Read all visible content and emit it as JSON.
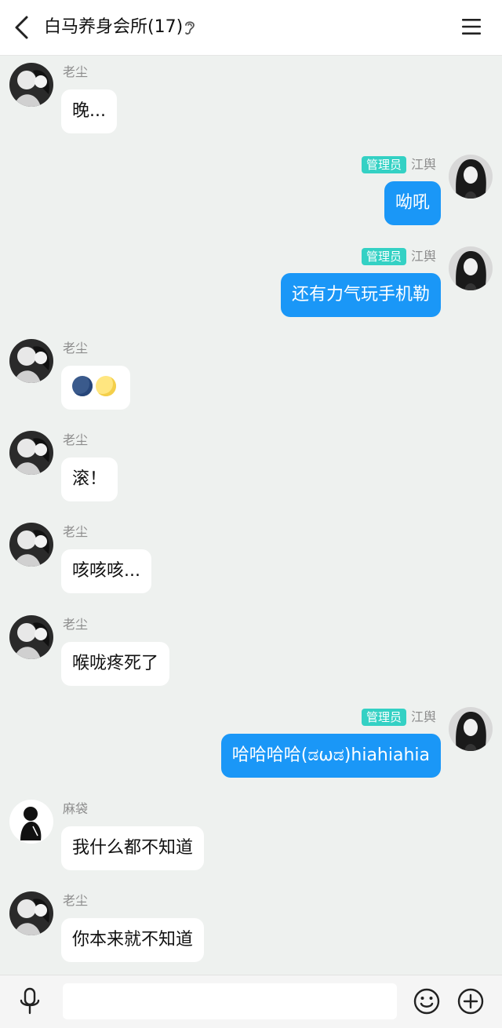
{
  "header": {
    "title": "白马养身会所(17)",
    "back_icon": "chevron-left-icon",
    "ear_icon": "ear-icon",
    "menu_icon": "hamburger-menu-icon"
  },
  "messages": [
    {
      "side": "left",
      "sender": "老尘",
      "text": "晚..."
    },
    {
      "side": "right",
      "sender": "江舆",
      "badge": "管理员",
      "text": "呦吼"
    },
    {
      "side": "right",
      "sender": "江舆",
      "badge": "管理员",
      "text": "还有力气玩手机勒"
    },
    {
      "side": "left",
      "sender": "老尘",
      "text": "",
      "emojis": [
        "new-moon-face",
        "full-moon-face"
      ]
    },
    {
      "side": "left",
      "sender": "老尘",
      "text": "滚！"
    },
    {
      "side": "left",
      "sender": "老尘",
      "text": "咳咳咳..."
    },
    {
      "side": "left",
      "sender": "老尘",
      "text": "喉咙疼死了"
    },
    {
      "side": "right",
      "sender": "江舆",
      "badge": "管理员",
      "text": "哈哈哈哈(ಡωಡ)hiahiahia"
    },
    {
      "side": "left",
      "sender": "麻袋",
      "text": "我什么都不知道"
    },
    {
      "side": "left",
      "sender": "老尘",
      "text": "你本来就不知道"
    }
  ],
  "input": {
    "value": "",
    "placeholder": ""
  },
  "icons": {
    "mic": "microphone-icon",
    "emoji": "smiley-icon",
    "plus": "plus-circle-icon"
  },
  "colors": {
    "background": "#eef1ef",
    "outgoing_bubble": "#1a97f7",
    "incoming_bubble": "#ffffff",
    "admin_badge": "#34d1c4"
  }
}
